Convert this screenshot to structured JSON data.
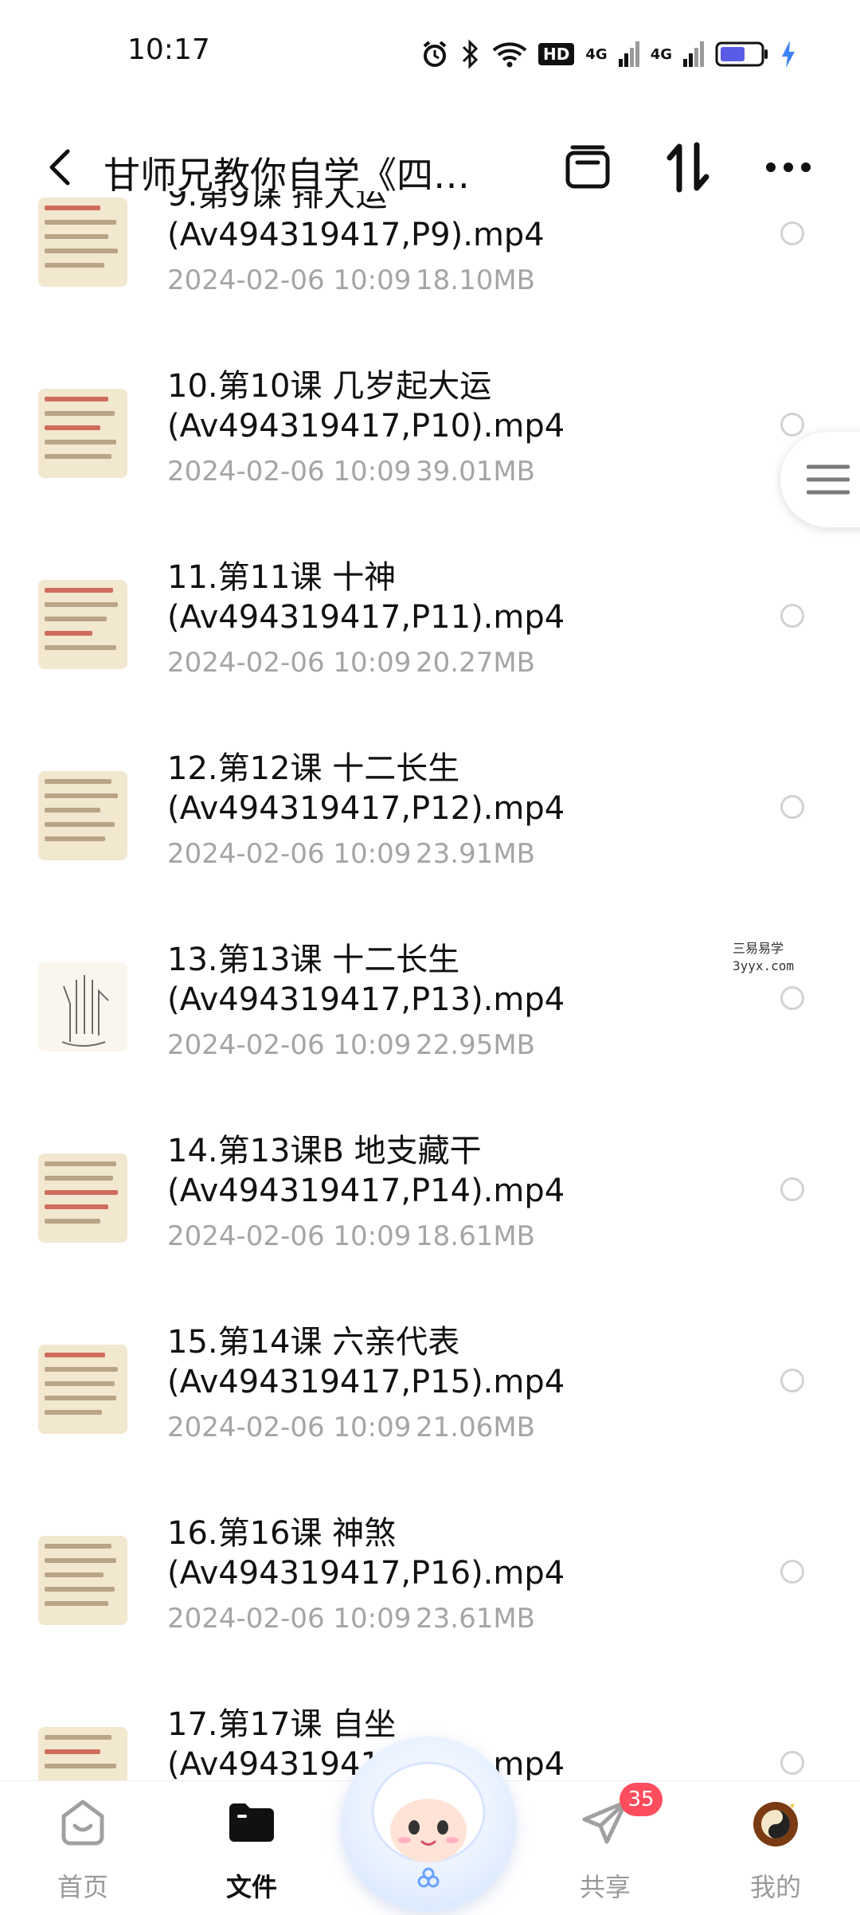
{
  "status_bar": {
    "time": "10:17",
    "network_label": "HD",
    "signal_1": "4G",
    "signal_2": "4G"
  },
  "header": {
    "title": "甘师兄教你自学《四…",
    "icons": [
      "back-icon",
      "archive-icon",
      "sort-icon",
      "more-icon"
    ]
  },
  "files": [
    {
      "name_line1": "9.第9课 排大运",
      "name_line2": "(Av494319417,P9).mp4",
      "date": "2024-02-06  10:09",
      "size": "18.10MB"
    },
    {
      "name_line1": "10.第10课 几岁起大运",
      "name_line2": "(Av494319417,P10).mp4",
      "date": "2024-02-06  10:09",
      "size": "39.01MB"
    },
    {
      "name_line1": "11.第11课 十神",
      "name_line2": "(Av494319417,P11).mp4",
      "date": "2024-02-06  10:09",
      "size": "20.27MB"
    },
    {
      "name_line1": "12.第12课 十二长生",
      "name_line2": "(Av494319417,P12).mp4",
      "date": "2024-02-06  10:09",
      "size": "23.91MB"
    },
    {
      "name_line1": "13.第13课 十二长生",
      "name_line2": "(Av494319417,P13).mp4",
      "date": "2024-02-06  10:09",
      "size": "22.95MB"
    },
    {
      "name_line1": "14.第13课B 地支藏干",
      "name_line2": "(Av494319417,P14).mp4",
      "date": "2024-02-06  10:09",
      "size": "18.61MB"
    },
    {
      "name_line1": "15.第14课 六亲代表",
      "name_line2": "(Av494319417,P15).mp4",
      "date": "2024-02-06  10:09",
      "size": "21.06MB"
    },
    {
      "name_line1": "16.第16课 神煞",
      "name_line2": "(Av494319417,P16).mp4",
      "date": "2024-02-06  10:09",
      "size": "23.61MB"
    },
    {
      "name_line1": "17.第17课 自坐",
      "name_line2": "(Av494319417,P17).mp4",
      "date": "",
      "size": ""
    }
  ],
  "watermark": {
    "line1": "三易易学",
    "line2": "3yyx.com"
  },
  "bottom_nav": {
    "home": "首页",
    "files": "文件",
    "share": "共享",
    "mine": "我的",
    "share_badge": "35"
  },
  "colors": {
    "accent": "#111111",
    "secondary_text": "#a5a5a5",
    "badge": "#ff4d5e",
    "thumb_bg": "#f2e7cf"
  }
}
